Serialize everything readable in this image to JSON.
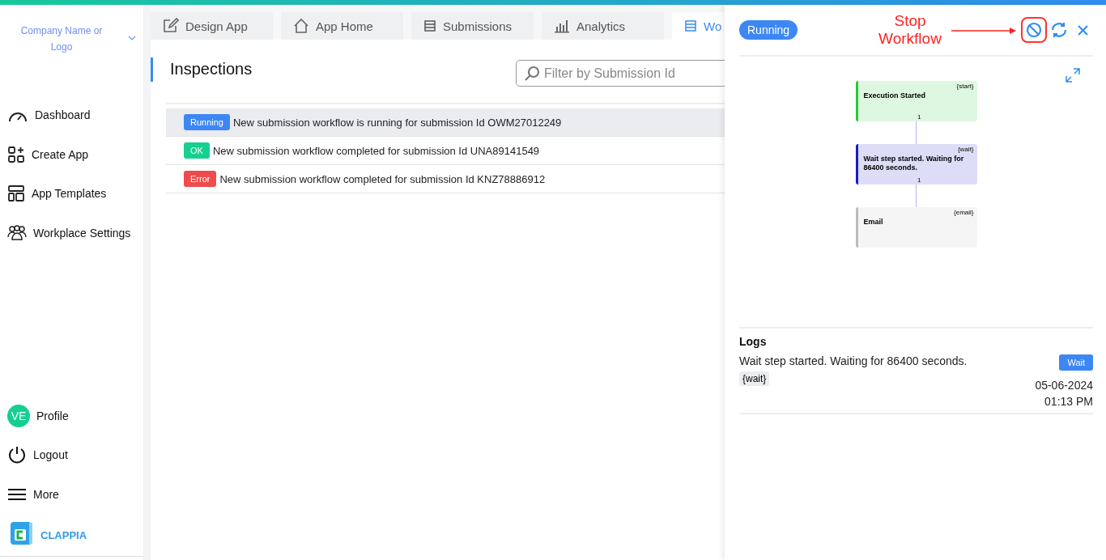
{
  "brand": {
    "company": "Company Name or Logo"
  },
  "nav": [
    {
      "label": "Dashboard"
    },
    {
      "label": "Create App"
    },
    {
      "label": "App Templates"
    },
    {
      "label": "Workplace Settings"
    }
  ],
  "bottom_nav": [
    {
      "label": "Profile",
      "kind": "avatar",
      "initials": "VE"
    },
    {
      "label": "Logout",
      "kind": "power"
    },
    {
      "label": "More",
      "kind": "menu"
    }
  ],
  "logo": {
    "text": "CLAPPIA"
  },
  "tabs": [
    {
      "label": "Design App",
      "selected": false
    },
    {
      "label": "App Home",
      "selected": false
    },
    {
      "label": "Submissions",
      "selected": false
    },
    {
      "label": "Analytics",
      "selected": false
    },
    {
      "label": "Wo",
      "selected": true
    }
  ],
  "page": {
    "title": "Inspections",
    "search": {
      "placeholder": "Filter by Submission Id"
    }
  },
  "runs": [
    {
      "status": "Running",
      "kind": "running",
      "message": "New submission workflow is running for submission Id OWM27012249",
      "selected": true
    },
    {
      "status": "OK",
      "kind": "ok",
      "message": "New submission workflow completed for submission Id UNA89141549",
      "selected": false
    },
    {
      "status": "Error",
      "kind": "error",
      "message": "New submission workflow completed for submission Id KNZ78886912",
      "selected": false
    }
  ],
  "panel": {
    "status": "Running",
    "annotation": "Stop Workflow",
    "nodes": [
      {
        "title": "Execution Started",
        "tag": "{start}",
        "count": "1",
        "color": "#22cc33"
      },
      {
        "title": "Wait step started. Waiting for 86400 seconds.",
        "tag": "{wait}",
        "count": "1",
        "color": "#1a1acc"
      },
      {
        "title": "Email",
        "tag": "{email}",
        "color": "#bbbbbb"
      }
    ],
    "logs_title": "Logs",
    "logs": [
      {
        "message": "Wait step started. Waiting for 86400 seconds.",
        "tag": "{wait}",
        "badge": "Wait",
        "date": "05-06-2024",
        "time": "01:13 PM"
      }
    ]
  }
}
